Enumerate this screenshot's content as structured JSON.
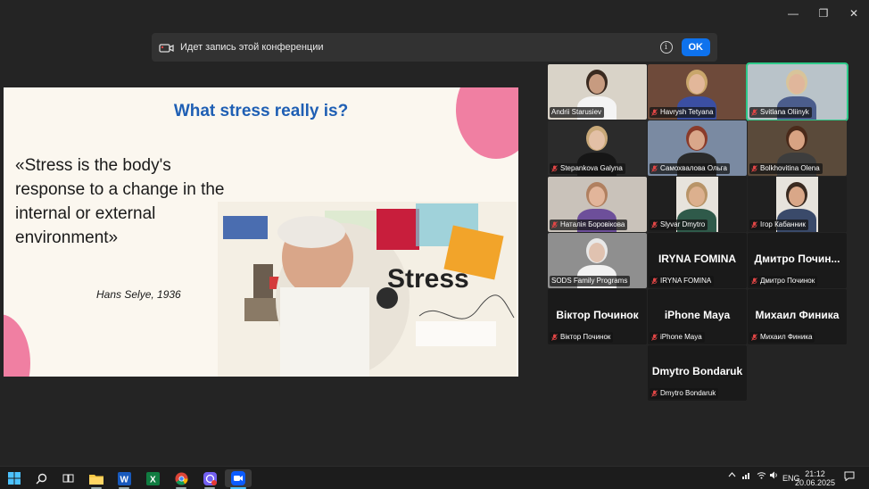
{
  "window": {
    "minimize": "—",
    "maximize": "❐",
    "close": "✕"
  },
  "banner": {
    "text": "Идет запись этой конференции",
    "info": "i",
    "ok": "OK"
  },
  "slide": {
    "title": "What stress really is?",
    "quote": "«Stress is the body's response to a change in the internal or external environment»",
    "author": "Hans Selye, 1936",
    "collage_word": "Stress"
  },
  "participants": [
    {
      "name": "Andrii Starusiev",
      "muted": false,
      "video": true,
      "active": false
    },
    {
      "name": "Havrysh Tetyana",
      "muted": true,
      "video": true,
      "active": false
    },
    {
      "name": "Svitlana Oliinyk",
      "muted": true,
      "video": true,
      "active": true
    },
    {
      "name": "Stepankova Galyna",
      "muted": true,
      "video": true,
      "active": false
    },
    {
      "name": "Самохвалова Ольга",
      "muted": true,
      "video": true,
      "active": false
    },
    {
      "name": "Bolkhovitina Olena",
      "muted": true,
      "video": true,
      "active": false
    },
    {
      "name": "Наталія Боровікова",
      "muted": true,
      "video": true,
      "active": false
    },
    {
      "name": "Slyvar Dmytro",
      "muted": true,
      "video": true,
      "active": false
    },
    {
      "name": "Ігор Кабанник",
      "muted": true,
      "video": true,
      "active": false
    },
    {
      "name": "SODS Family Programs",
      "muted": false,
      "video": true,
      "active": false
    },
    {
      "name": "IRYNA FOMINA",
      "display": "IRYNA FOMINA",
      "muted": true,
      "video": false,
      "active": false
    },
    {
      "name": "Дмитро Починок",
      "display": "Дмитро Почин...",
      "muted": true,
      "video": false,
      "active": false
    },
    {
      "name": "Віктор Починок",
      "display": "Віктор Починок",
      "muted": true,
      "video": false,
      "active": false
    },
    {
      "name": "iPhone Maya",
      "display": "iPhone Maya",
      "muted": true,
      "video": false,
      "active": false
    },
    {
      "name": "Михаил Финика",
      "display": "Михаил Финика",
      "muted": true,
      "video": false,
      "active": false
    },
    {
      "name": "Dmytro Bondaruk",
      "display": "Dmytro Bondaruk",
      "muted": true,
      "video": false,
      "active": false
    }
  ],
  "taskbar": {
    "lang": "ENG",
    "time": "21:12",
    "date": "20.06.2025"
  }
}
